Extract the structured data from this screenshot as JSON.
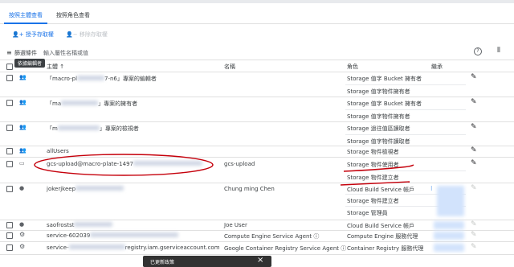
{
  "tabs": [
    {
      "label": "按照主體查看",
      "active": true
    },
    {
      "label": "按照角色查看",
      "active": false
    }
  ],
  "actions": {
    "add": "授予存取權",
    "remove": "移除存取權"
  },
  "filter": {
    "label": "篩選條件",
    "placeholder": "輸入屬性名稱或值"
  },
  "tooltip": "依據編輯者",
  "columns": {
    "principal": "主體",
    "name": "名稱",
    "role": "角色",
    "inherited": "繼承"
  },
  "rows": [
    {
      "principal": "「macro-pl",
      "principal_tail": "7-n6」專案的編輯者",
      "name": "",
      "roles": [
        "Storage 值字 Bucket 擁有者",
        "Storage 值字物件擁有者"
      ]
    },
    {
      "principal": "「ma",
      "principal_tail": "」專案的擁有者",
      "name": "",
      "roles": [
        "Storage 值字 Bucket 擁有者",
        "Storage 值字物件擁有者"
      ]
    },
    {
      "principal": "「m",
      "principal_tail": "」專案的檢視者",
      "name": "",
      "roles": [
        "Storage 過往值區讀取者",
        "Storage 值字物件讀取者"
      ]
    },
    {
      "principal": "allUsers",
      "principal_tail": "",
      "name": "",
      "roles": [
        "Storage 物件檢視者"
      ]
    },
    {
      "principal": "gcs-upload@macro-plate-1497",
      "principal_tail": "",
      "name": "gcs-upload",
      "roles": [
        "Storage 物件使用者",
        "Storage 物件建立者"
      ]
    },
    {
      "principal": "jokerjkeep",
      "principal_tail": "",
      "name": "Chung ming Chen",
      "roles": [
        "Cloud Build Service 帳戶",
        "Storage 物件建立者",
        "Storage 管理員"
      ]
    },
    {
      "principal": "saofrostst",
      "principal_tail": "",
      "name": "Joe User",
      "roles": [
        "Cloud Build Service 帳戶"
      ]
    },
    {
      "principal": "service-602039",
      "principal_tail": "",
      "name": "Compute Engine Service Agent",
      "roles": [
        "Compute Engine 服務代理"
      ]
    },
    {
      "principal": "service-",
      "principal_tail": "registry.iam.gserviceaccount.com",
      "name": "Google Container Registry Service Agent",
      "roles": [
        "Container Registry 服務代理"
      ]
    }
  ],
  "snackbar": "已更新政策",
  "icons": {
    "add": "person-add-icon",
    "remove": "person-remove-icon",
    "filter": "filter-icon",
    "help": "help-icon",
    "columns": "column-toggle-icon",
    "edit": "edit-pencil-icon",
    "group": "group-icon",
    "service": "service-account-icon",
    "person": "person-icon",
    "settings": "settings-gear-icon",
    "close": "close-icon"
  }
}
